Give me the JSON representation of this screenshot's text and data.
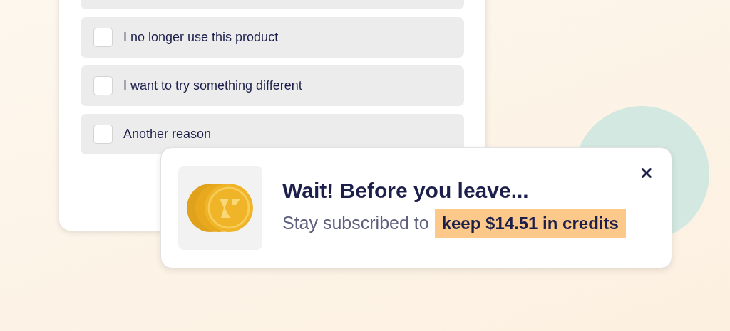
{
  "reasons": [
    {
      "label": "I no longer use this product",
      "checked": false
    },
    {
      "label": "I want to try something different",
      "checked": false
    },
    {
      "label": "Another reason",
      "checked": false
    }
  ],
  "toast": {
    "title": "Wait! Before you leave...",
    "message": "Stay subscribed to",
    "highlight": "keep $14.51 in credits"
  }
}
